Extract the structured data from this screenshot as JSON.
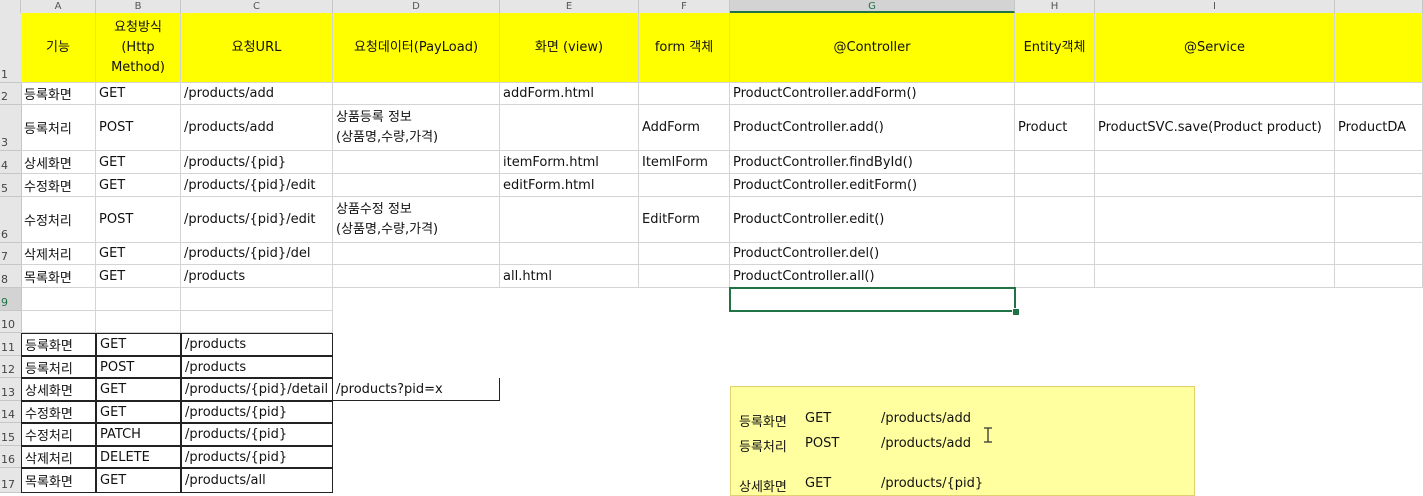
{
  "column_letters": [
    "A",
    "B",
    "C",
    "D",
    "E",
    "F",
    "G",
    "H",
    "I"
  ],
  "row_numbers": [
    "1",
    "2",
    "3",
    "4",
    "5",
    "6",
    "7",
    "8",
    "9",
    "10",
    "11",
    "12",
    "13",
    "14",
    "15",
    "16",
    "17"
  ],
  "headers": {
    "a": "기능",
    "b": "요청방식 (Http Method)",
    "c": "요청URL",
    "d": "요청데이터(PayLoad)",
    "e": "화면 (view)",
    "f": "form 객체",
    "g": "@Controller",
    "h": "Entity객체",
    "i": "@Service"
  },
  "rows": [
    {
      "a": "등록화면",
      "b": "GET",
      "c": "/products/add",
      "d": "",
      "e": "addForm.html",
      "f": "",
      "g": "ProductController.addForm()",
      "h": "",
      "i": "",
      "j": ""
    },
    {
      "a": "등록처리",
      "b": "POST",
      "c": "/products/add",
      "d": "상품등록 정보\n(상품명,수량,가격)",
      "e": "",
      "f": "AddForm",
      "g": "ProductController.add()",
      "h": "Product",
      "i": "ProductSVC.save(Product product)",
      "j": "ProductDA"
    },
    {
      "a": "상세화면",
      "b": "GET",
      "c": "/products/{pid}",
      "d": "",
      "e": "itemForm.html",
      "f": "ItemlForm",
      "g": "ProductController.findById()",
      "h": "",
      "i": "",
      "j": ""
    },
    {
      "a": "수정화면",
      "b": "GET",
      "c": "/products/{pid}/edit",
      "d": "",
      "e": "editForm.html",
      "f": "",
      "g": "ProductController.editForm()",
      "h": "",
      "i": "",
      "j": ""
    },
    {
      "a": "수정처리",
      "b": "POST",
      "c": "/products/{pid}/edit",
      "d": "상품수정 정보\n(상품명,수량,가격)",
      "e": "",
      "f": "EditForm",
      "g": "ProductController.edit()",
      "h": "",
      "i": "",
      "j": ""
    },
    {
      "a": "삭제처리",
      "b": "GET",
      "c": "/products/{pid}/del",
      "d": "",
      "e": "",
      "f": "",
      "g": "ProductController.del()",
      "h": "",
      "i": "",
      "j": ""
    },
    {
      "a": "목록화면",
      "b": "GET",
      "c": "/products",
      "d": "",
      "e": "all.html",
      "f": "",
      "g": "ProductController.all()",
      "h": "",
      "i": "",
      "j": ""
    }
  ],
  "rest_rows": [
    {
      "a": "등록화면",
      "b": "GET",
      "c": "/products",
      "d": ""
    },
    {
      "a": "등록처리",
      "b": "POST",
      "c": "/products",
      "d": ""
    },
    {
      "a": "상세화면",
      "b": "GET",
      "c": "/products/{pid}/detail",
      "d": "/products?pid=x"
    },
    {
      "a": "수정화면",
      "b": "GET",
      "c": "/products/{pid}",
      "d": ""
    },
    {
      "a": "수정처리",
      "b": "PATCH",
      "c": "/products/{pid}",
      "d": ""
    },
    {
      "a": "삭제처리",
      "b": "DELETE",
      "c": "/products/{pid}",
      "d": ""
    },
    {
      "a": "목록화면",
      "b": "GET",
      "c": "/products/all",
      "d": ""
    }
  ],
  "pasted": [
    {
      "a": "등록화면",
      "b": "GET",
      "c": "/products/add"
    },
    {
      "a": "등록처리",
      "b": "POST",
      "c": "/products/add"
    },
    {
      "a": "",
      "b": "",
      "c": ""
    },
    {
      "a": "상세화면",
      "b": "GET",
      "c": "/products/{pid}"
    }
  ],
  "colors": {
    "header_fill": "#ffff00",
    "paste_fill": "#ffff9f",
    "selection": "#217346"
  },
  "icons": {
    "cursor": "text-cursor-icon"
  }
}
